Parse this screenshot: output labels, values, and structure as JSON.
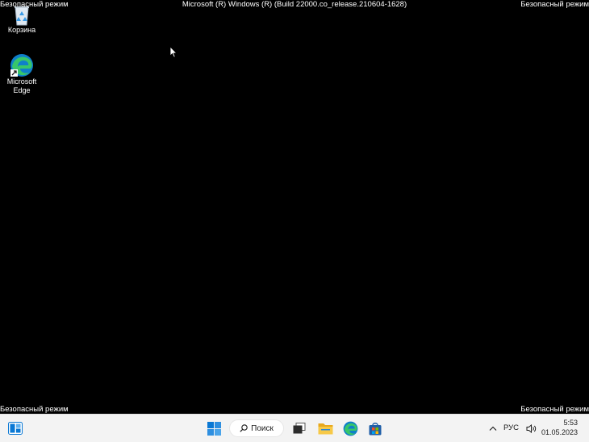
{
  "overlay": {
    "safe_mode_label": "Безопасный режим",
    "build_info": "Microsoft (R) Windows (R) (Build 22000.co_release.210604-1628)"
  },
  "desktop": {
    "icons": [
      {
        "label": "Корзина",
        "icon": "recycle-bin-icon"
      },
      {
        "label": "Microsoft Edge",
        "icon": "edge-icon"
      }
    ]
  },
  "taskbar": {
    "search_label": "Поиск",
    "apps": [
      "widgets-icon",
      "start-icon",
      "task-view-icon",
      "file-explorer-icon",
      "edge-icon",
      "store-icon"
    ],
    "tray": {
      "language": "РУС",
      "time": "5:53",
      "date": "01.05.2023"
    }
  },
  "colors": {
    "desktop_bg": "#000000",
    "taskbar_bg": "#f3f3f3",
    "accent_blue": "#0a78d4"
  }
}
